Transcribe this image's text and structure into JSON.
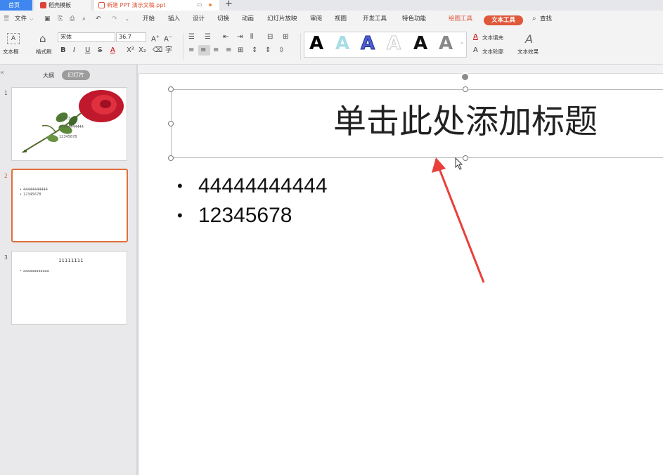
{
  "tabs": {
    "home": "首页",
    "template": "稻壳模板",
    "doc": "新建 PPT 演示文稿.ppt"
  },
  "menubar": {
    "file": "文件",
    "items": [
      "开始",
      "插入",
      "设计",
      "切换",
      "动画",
      "幻灯片放映",
      "审阅",
      "视图",
      "开发工具",
      "特色功能"
    ],
    "draw_tools": "绘图工具",
    "text_tools": "文本工具",
    "search": "查找"
  },
  "ribbon": {
    "textbox": "文本框",
    "format_painter": "格式刷",
    "font_name": "宋体",
    "font_size": "36.7",
    "text_fill": "文本填充",
    "text_outline": "文本轮廓",
    "text_effect": "文本效果"
  },
  "panel": {
    "outline_tab": "大纲",
    "slides_tab": "幻灯片"
  },
  "thumbnails": [
    {
      "number": "1",
      "lines": [
        "11123",
        "44444444444",
        "12345678"
      ]
    },
    {
      "number": "2",
      "lines": [
        "44444444444",
        "12345678"
      ]
    },
    {
      "number": "3",
      "title": "11111111",
      "lines": [
        "aaaaaaaaaaaa"
      ]
    }
  ],
  "slide": {
    "title_placeholder": "单击此处添加标题",
    "bullets": [
      "44444444444",
      "12345678"
    ]
  },
  "colors": {
    "accent": "#e0573a",
    "home_tab": "#3f87f0",
    "arrow": "#e8403a"
  }
}
